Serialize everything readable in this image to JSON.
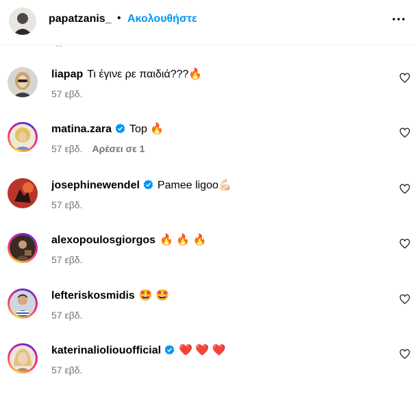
{
  "header": {
    "username": "papatzanis_",
    "dot": "•",
    "follow_label": "Ακολουθήστε",
    "more_icon": "more-horizontal-icon"
  },
  "partial_row_text": "...",
  "comments": [
    {
      "username": "liapap",
      "verified": false,
      "text": "Τι έγινε ρε παιδιά???🔥",
      "time": "57 εβδ.",
      "likes": "",
      "avatar_ring": false
    },
    {
      "username": "matina.zara",
      "verified": true,
      "text": "Top  🔥",
      "time": "57 εβδ.",
      "likes": "Αρέσει σε 1",
      "avatar_ring": true
    },
    {
      "username": "josephinewendel",
      "verified": true,
      "text": "Pamee ligoo💪🏻",
      "time": "57 εβδ.",
      "likes": "",
      "avatar_ring": false
    },
    {
      "username": "alexopoulosgiorgos",
      "verified": false,
      "text": "🔥 🔥 🔥",
      "time": "57 εβδ.",
      "likes": "",
      "avatar_ring": true
    },
    {
      "username": "lefteriskosmidis",
      "verified": false,
      "text": "🤩 🤩",
      "time": "57 εβδ.",
      "likes": "",
      "avatar_ring": true
    },
    {
      "username": "katerinalioliouofficial",
      "verified": true,
      "text": "❤️ ❤️ ❤️",
      "time": "57 εβδ.",
      "likes": "",
      "avatar_ring": true
    }
  ],
  "colors": {
    "follow": "#0095f6",
    "verified": "#0095f6",
    "meta": "#737373"
  }
}
